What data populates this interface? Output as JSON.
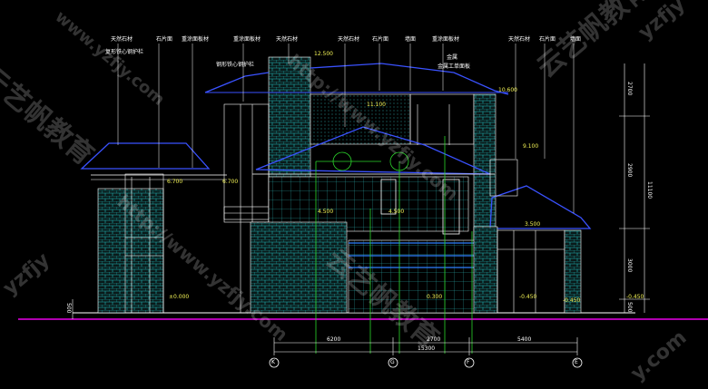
{
  "labels": {
    "top": [
      "天然石材",
      "石片面",
      "重涂面板材",
      "重涂面板材",
      "天然石材",
      "天然石材",
      "石片面",
      "墙面",
      "重涂面板材",
      "天然石材",
      "石片面",
      "墙面"
    ],
    "mid": [
      "复形铁心钢护栏",
      "钢形铁心钢护栏",
      "金属",
      "金属工单面板"
    ],
    "elev": [
      "12.500",
      "11.100",
      "10.600",
      "9.100",
      "6.700",
      "6.700",
      "4.500",
      "4.500",
      "3.500",
      "±0.000",
      "0.300",
      "-0.450",
      "-0.450",
      "-0.450"
    ]
  },
  "dims": {
    "bottom": [
      "6200",
      "2700",
      "5400"
    ],
    "total": "15300",
    "right": [
      "2700",
      "2900",
      "3000",
      "500",
      "11100"
    ],
    "left": [
      "500"
    ]
  },
  "axes": [
    "K",
    "G",
    "F",
    "E"
  ],
  "watermarks": [
    "yzfjy",
    "www.yzfjy.com",
    "http://www.yzfjy.com",
    "云艺帆教育",
    "云艺帆教育",
    "yzfjy",
    "http://www.yzfjy.com",
    "云艺帆教育",
    "y.com"
  ]
}
